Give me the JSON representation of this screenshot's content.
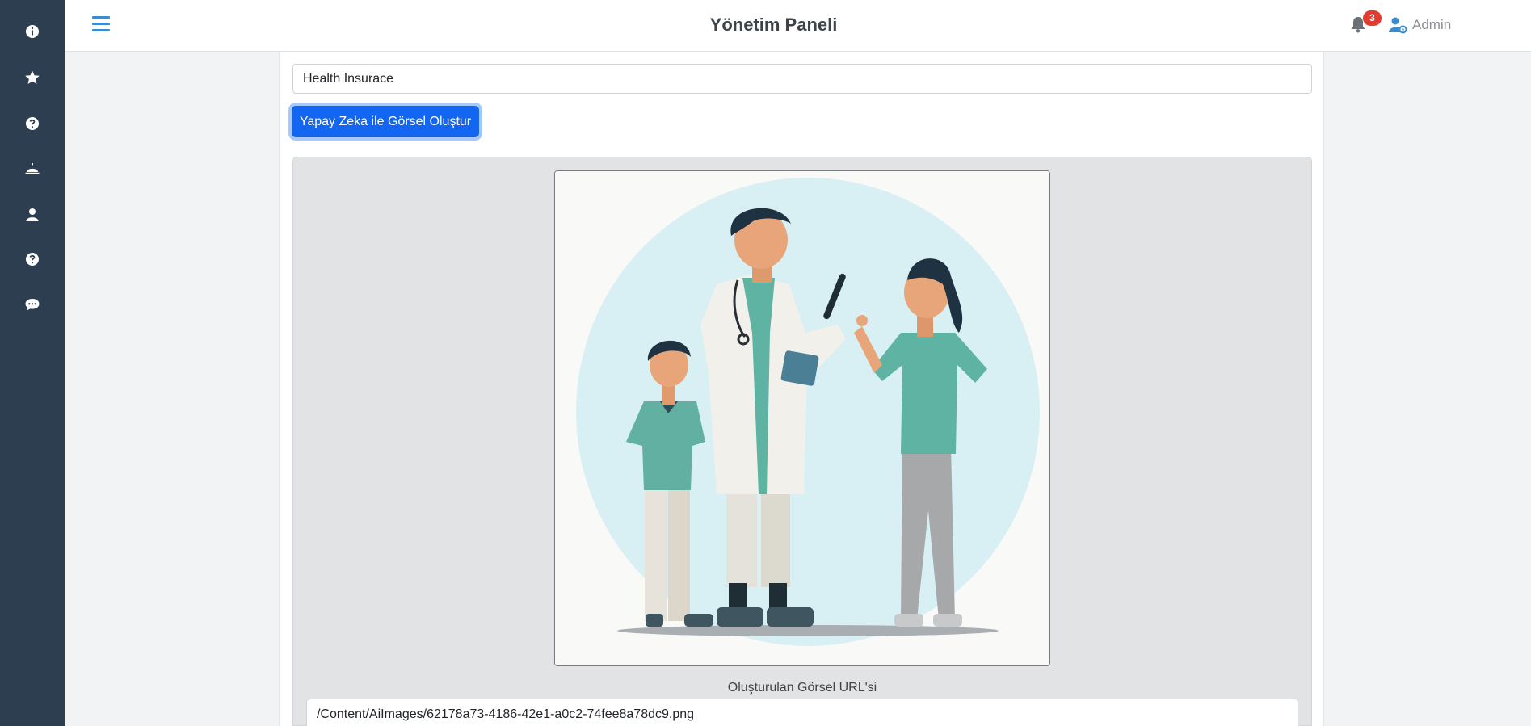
{
  "header": {
    "title": "Yönetim Paneli",
    "notification_count": "3",
    "user_name": "Admin"
  },
  "sidebar": {
    "items": [
      {
        "icon": "info-icon"
      },
      {
        "icon": "star-icon"
      },
      {
        "icon": "question-icon"
      },
      {
        "icon": "bell-service-icon"
      },
      {
        "icon": "user-icon"
      },
      {
        "icon": "question-icon"
      },
      {
        "icon": "chat-icon"
      }
    ]
  },
  "form": {
    "prompt_value": "Health Insurace",
    "generate_label": "Yapay Zeka ile Görsel Oluştur",
    "url_label": "Oluşturulan Görsel URL'si",
    "url_value": "/Content/AiImages/62178a73-4186-42e1-a0c2-74fee8a78dc9.png"
  },
  "colors": {
    "sidebar_bg": "#2c3e50",
    "accent": "#3a8bd0",
    "primary_button": "#1266f1",
    "badge": "#e23b2f"
  }
}
